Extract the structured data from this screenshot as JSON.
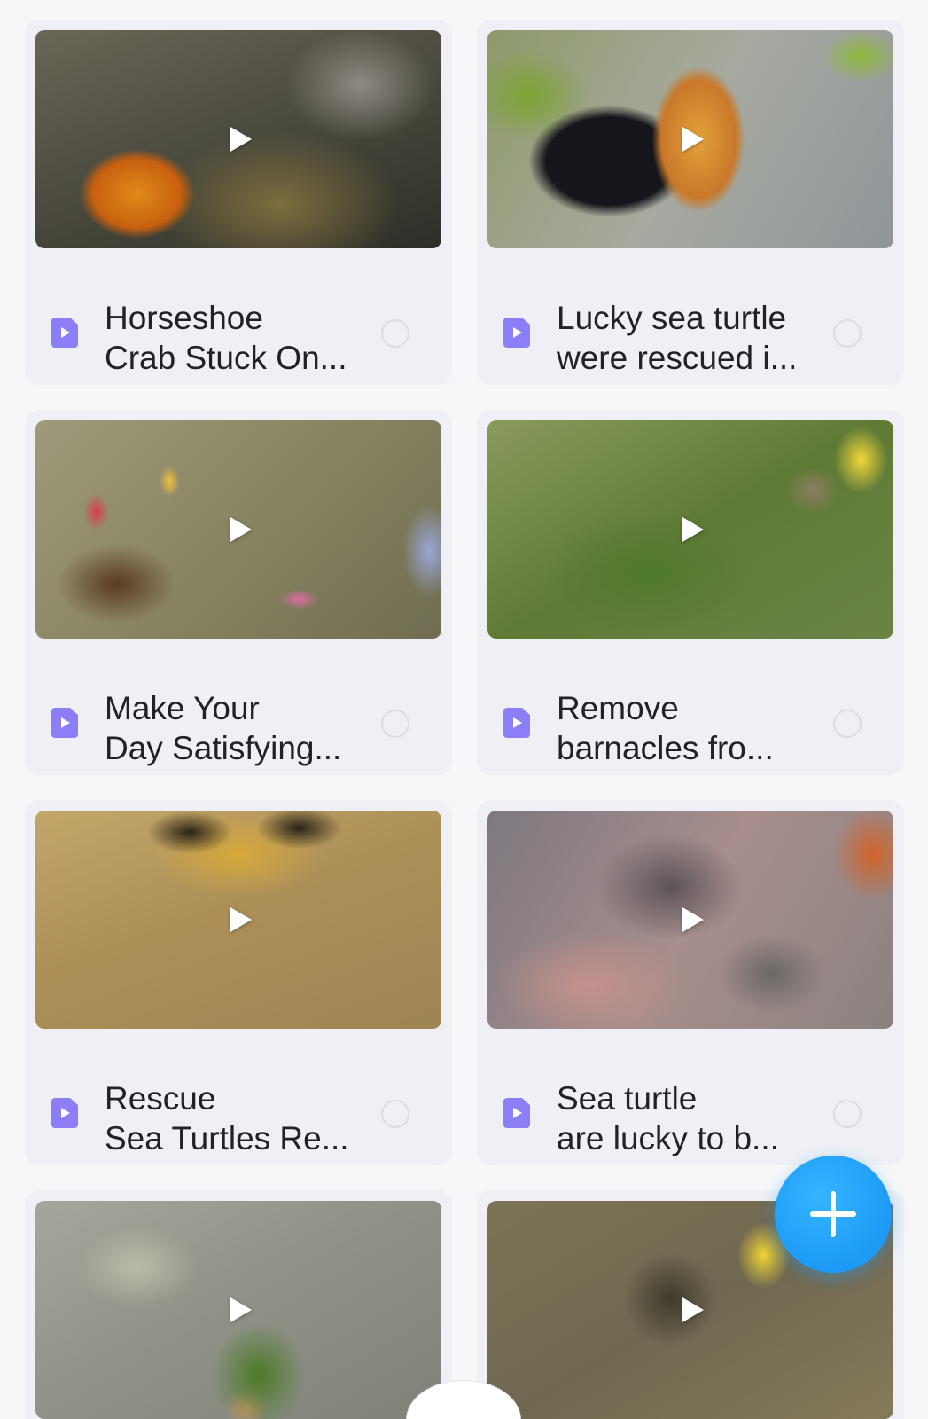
{
  "videos": [
    {
      "title": "Horseshoe\nCrab Stuck On...",
      "thumb": "horseshoe-crab"
    },
    {
      "title": "Lucky sea turtle\nwere rescued i...",
      "thumb": "turtle-gloves"
    },
    {
      "title": "Make Your\nDay Satisfying...",
      "thumb": "net-debris"
    },
    {
      "title": "Remove\nbarnacles fro...",
      "thumb": "green-seaweed"
    },
    {
      "title": "Rescue\nSea Turtles Re...",
      "thumb": "sandy-bee-socks"
    },
    {
      "title": "Sea turtle\nare lucky to b...",
      "thumb": "rocky-pink"
    },
    {
      "title": "",
      "thumb": "grey-seaweed"
    },
    {
      "title": "",
      "thumb": "sand-turtle"
    }
  ],
  "icons": {
    "play": "play-icon",
    "file": "video-file-icon",
    "select": "select-circle-icon",
    "fab": "plus-icon"
  },
  "colors": {
    "accent": "#1c9af6",
    "file_icon": "#8c7ef6",
    "card_bg": "#eef0f5",
    "page_bg": "#f7f7f9"
  }
}
